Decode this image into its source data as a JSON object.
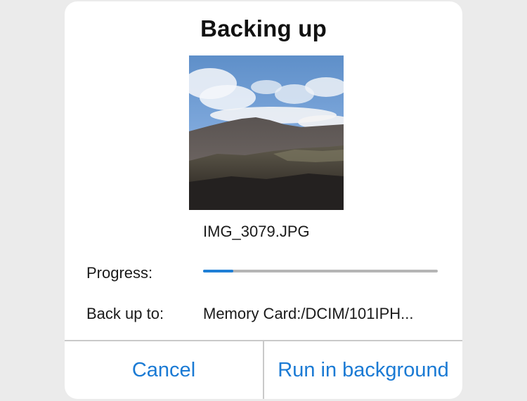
{
  "dialog": {
    "title": "Backing up",
    "thumbnail": {
      "alt": "mountain photo thumbnail"
    },
    "filename": "IMG_3079.JPG",
    "progress": {
      "label": "Progress:",
      "fraction": 0.13
    },
    "destination": {
      "label": "Back up to:",
      "value": "Memory Card:/DCIM/101IPH..."
    },
    "buttons": {
      "cancel": "Cancel",
      "background": "Run in background"
    }
  },
  "colors": {
    "accent": "#1a7ad4",
    "progress_fill": "#1f7fd6",
    "progress_track": "#b5b5b5",
    "backdrop": "#ebebeb"
  }
}
